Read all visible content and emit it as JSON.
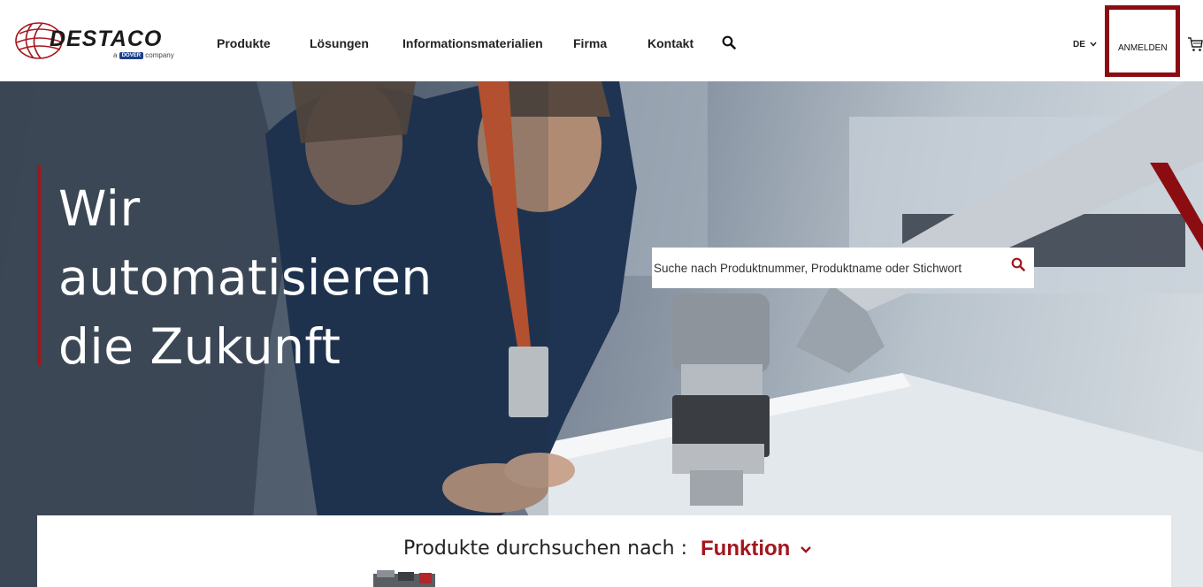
{
  "brand": {
    "logo_text": "DESTACO",
    "tag_prefix": "a",
    "tag_badge": "DOVER",
    "tag_suffix": "company"
  },
  "nav": {
    "items": [
      "Produkte",
      "Lösungen",
      "Informationsmaterialien",
      "Firma",
      "Kontakt"
    ],
    "search_icon": "search-icon"
  },
  "header_right": {
    "language": "DE",
    "language_icon": "chevron-down-icon",
    "login": "ANMELDEN",
    "cart_icon": "cart-icon"
  },
  "hero": {
    "title_lines": [
      "Wir",
      "automatisieren",
      "die Zukunft"
    ],
    "search_placeholder": "Suche nach Produktnummer, Produktname oder Stichwort",
    "search_icon": "search-icon"
  },
  "browse": {
    "label": "Produkte durchsuchen nach :",
    "selected": "Funktion",
    "selected_icon": "chevron-down-icon"
  },
  "colors": {
    "brand_red": "#a3161c",
    "highlight": "#8b0d12"
  }
}
